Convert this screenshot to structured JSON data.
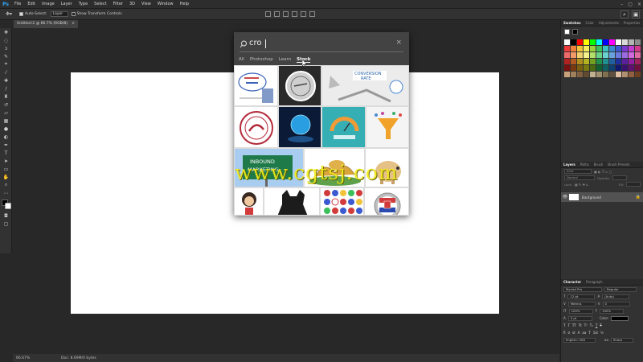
{
  "app": {
    "logo": "Ps",
    "menu": [
      "File",
      "Edit",
      "Image",
      "Layer",
      "Type",
      "Select",
      "Filter",
      "3D",
      "View",
      "Window",
      "Help"
    ]
  },
  "options": {
    "auto_select_label": "Auto-Select:",
    "auto_select_value": "Layer",
    "transform_label": "Show Transform Controls",
    "mode3d_label": "3D Mode:"
  },
  "document": {
    "tab_title": "Untitled-2 @ 66.7% (RGB/8)",
    "tab_close": "×",
    "zoom": "66.67%",
    "doc_info": "Doc: 8.69M/0 bytes"
  },
  "search": {
    "query": "cro",
    "tabs": [
      "All",
      "Photoshop",
      "Learn",
      "Stock"
    ],
    "active_tab": "Stock",
    "close": "×"
  },
  "stock_images": [
    {
      "name": "Cloud chart diagram"
    },
    {
      "name": "Round stamp"
    },
    {
      "name": "Conversion rate arrows"
    },
    {
      "name": "Red circle stamp"
    },
    {
      "name": "Blue globe hands"
    },
    {
      "name": "Conversion gauge"
    },
    {
      "name": "Funnel diagram"
    },
    {
      "name": "Inbound marketing sign"
    },
    {
      "name": "Croissants plate"
    },
    {
      "name": "Piggy bank"
    },
    {
      "name": "Cartoon woman"
    },
    {
      "name": "French bulldog"
    },
    {
      "name": "Flag buttons"
    },
    {
      "name": "Croatia flag badge"
    }
  ],
  "watermark": "www.cgtsj.com",
  "panels": {
    "swatch_tabs": [
      "Swatches",
      "Color",
      "Adjustments",
      "Properties"
    ],
    "layers_tabs": [
      "Layers",
      "Paths",
      "Brush",
      "Brush Presets"
    ],
    "layer_kind": "Kind",
    "blend_mode": "Normal",
    "opacity_label": "Opacity:",
    "lock_label": "Lock:",
    "fill_label": "Fill:",
    "layer_name": "Background",
    "char_tabs": [
      "Character",
      "Paragraph"
    ],
    "font_family": "Myriad Pro",
    "font_style": "Regular",
    "font_size": "12 pt",
    "leading": "(Auto)",
    "kerning": "Metrics",
    "tracking": "0",
    "vscale": "100%",
    "hscale": "100%",
    "baseline": "0 pt",
    "color_label": "Color:",
    "language": "English: USA",
    "aa": "Sharp"
  },
  "colors": {
    "accent": "#31a8ff",
    "watermark": "#f3ea19",
    "swatches": [
      "#ffffff",
      "#000000",
      "#ff0000",
      "#ffff00",
      "#00ff00",
      "#00ffff",
      "#0000ff",
      "#ff00ff",
      "#ffffff",
      "#d9d9d9",
      "#b3b3b3",
      "#8c8c8c",
      "#ee3b3b",
      "#f07f3b",
      "#f0c33b",
      "#f5f05a",
      "#9ad23b",
      "#3bc05a",
      "#3bc3c3",
      "#3b8ad2",
      "#3b5ad2",
      "#7a3bd2",
      "#c33bd2",
      "#d23b8a",
      "#ee6a6a",
      "#f09a6a",
      "#f0d06a",
      "#f5f08a",
      "#b2e06a",
      "#6ad08a",
      "#6ad0d0",
      "#6aa2e0",
      "#6a7ae0",
      "#9a6ae0",
      "#d06ae0",
      "#e06aa2",
      "#b32020",
      "#b35a20",
      "#b38f20",
      "#b3b320",
      "#6fa020",
      "#20904a",
      "#209090",
      "#2060a0",
      "#2030a0",
      "#5a20a0",
      "#9020a0",
      "#a02060",
      "#7a1010",
      "#7a3a10",
      "#7a6010",
      "#7a7a10",
      "#4a6a10",
      "#106030",
      "#106060",
      "#104070",
      "#101a70",
      "#3a1070",
      "#601070",
      "#701040",
      "#c7a27a",
      "#a0805a",
      "#806040",
      "#604a30",
      "#c0b090",
      "#a09070",
      "#807050",
      "#605040",
      "#e0c0a0",
      "#b09070",
      "#906040",
      "#704020"
    ]
  }
}
